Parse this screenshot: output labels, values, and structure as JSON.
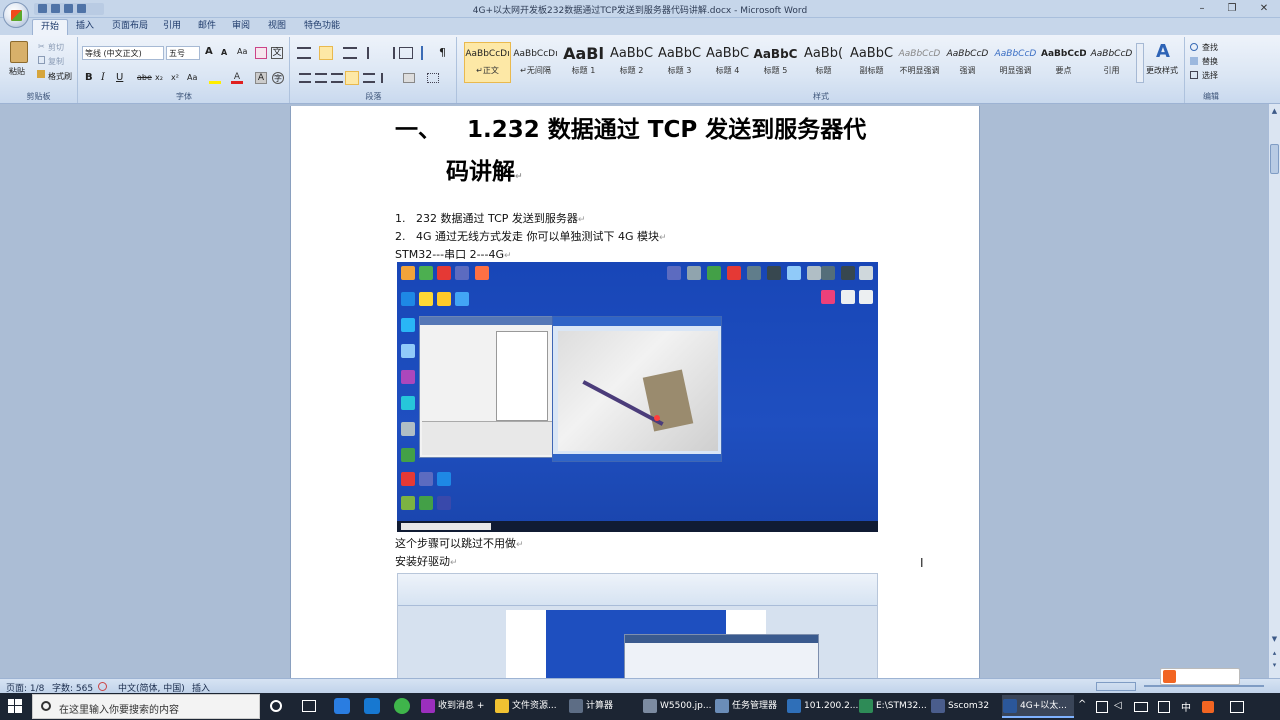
{
  "window": {
    "title": "4G+以太网开发板232数据通过TCP发送到服务器代码讲解.docx - Microsoft Word",
    "minimize": "–",
    "restore": "❐",
    "close": "✕"
  },
  "tabs": [
    "开始",
    "插入",
    "页面布局",
    "引用",
    "邮件",
    "审阅",
    "视图",
    "特色功能"
  ],
  "ribbon": {
    "clipboard": {
      "paste": "粘贴",
      "cut": "剪切",
      "copy": "复制",
      "format_painter": "格式刷",
      "label": "剪贴板"
    },
    "font": {
      "font_name": "等线 (中文正文)",
      "font_size": "五号",
      "label": "字体",
      "b": "B",
      "i": "I",
      "u": "U",
      "strike": "abe",
      "sub": "x₂",
      "sup": "x²",
      "aa": "Aa",
      "a_big": "A",
      "a_small": "A"
    },
    "paragraph": {
      "label": "段落"
    },
    "styles": {
      "label": "样式",
      "items": [
        {
          "preview": "AaBbCcDı",
          "name": "↵正文"
        },
        {
          "preview": "AaBbCcDı",
          "name": "↵无间隔"
        },
        {
          "preview": "AaBl",
          "name": "标题 1"
        },
        {
          "preview": "AaBbC",
          "name": "标题 2"
        },
        {
          "preview": "AaBbC",
          "name": "标题 3"
        },
        {
          "preview": "AaBbC",
          "name": "标题 4"
        },
        {
          "preview": "AaBbC",
          "name": "标题 5"
        },
        {
          "preview": "AaBb(",
          "name": "标题"
        },
        {
          "preview": "AaBbC",
          "name": "副标题"
        },
        {
          "preview": "AaBbCcD",
          "name": "不明显强调"
        },
        {
          "preview": "AaBbCcD",
          "name": "强调"
        },
        {
          "preview": "AaBbCcD",
          "name": "明显强调"
        },
        {
          "preview": "AaBbCcD",
          "name": "要点"
        },
        {
          "preview": "AaBbCcD",
          "name": "引用"
        }
      ],
      "change_styles": "更改样式"
    },
    "editing": {
      "label": "编辑",
      "find": "查找",
      "replace": "替换",
      "select": "选择"
    }
  },
  "document": {
    "heading_num": "一、",
    "heading_line1": "1.232 数据通过 TCP 发送到服务器代",
    "heading_line2": "码讲解",
    "list": [
      {
        "num": "1.",
        "text": "232 数据通过 TCP 发送到服务器"
      },
      {
        "num": "2.",
        "text": "4G 通过无线方式发走 你可以单独测试下 4G 模块"
      }
    ],
    "line3": "STM32---串口 2---4G",
    "line4": "这个步骤可以跳过不用做",
    "line5": "安装好驱动",
    "para_mark": "↵"
  },
  "statusbar": {
    "page": "页面: 1/8",
    "words": "字数: 565",
    "language": "中文(简体, 中国)",
    "mode": "插入"
  },
  "taskbar": {
    "search_placeholder": "在这里输入你要搜索的内容",
    "items": [
      {
        "label": "收到消息 +"
      },
      {
        "label": "文件资源..."
      },
      {
        "label": "计算器"
      },
      {
        "label": "W5500.jp..."
      },
      {
        "label": "任务管理器"
      },
      {
        "label": "101.200.2..."
      },
      {
        "label": "E:\\STM32..."
      },
      {
        "label": "Sscom32"
      },
      {
        "label": "4G+以太..."
      }
    ],
    "ime": "中"
  },
  "colors": {
    "ribbon_bg": "#dbe6f4",
    "doc_bg": "#abbdd5",
    "taskbar_bg": "#1c2533",
    "selected_style": "#fde8a6"
  }
}
